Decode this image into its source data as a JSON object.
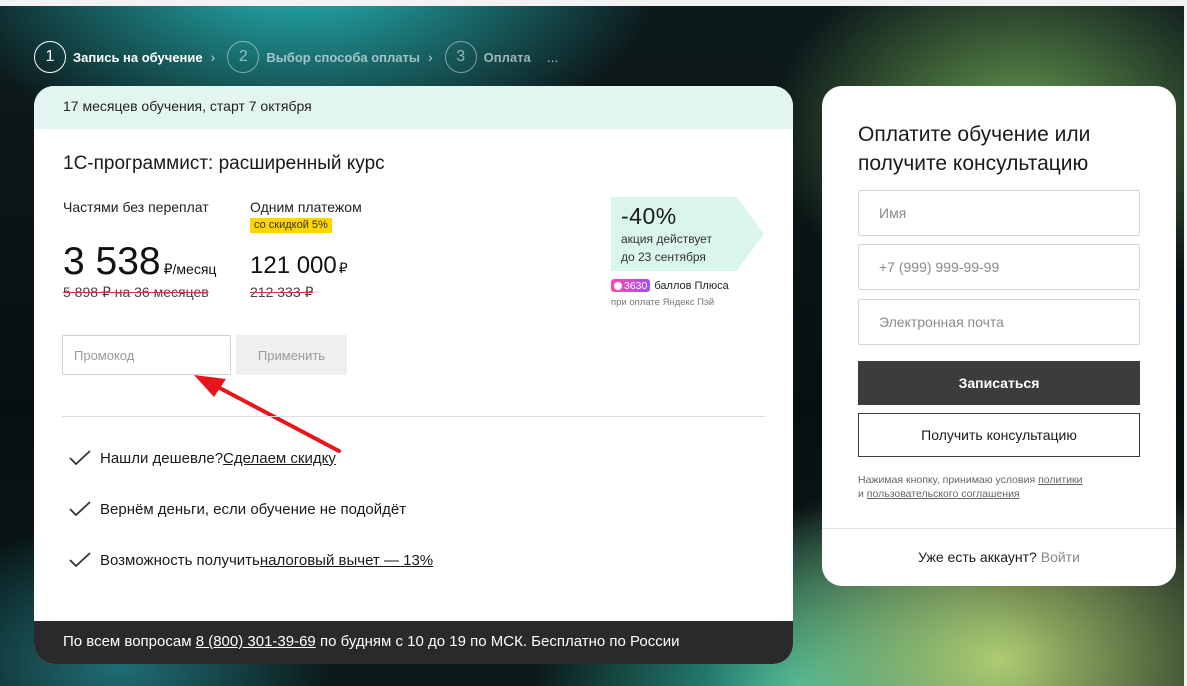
{
  "stepper": {
    "steps": [
      {
        "num": "1",
        "label": "Запись на обучение"
      },
      {
        "num": "2",
        "label": "Выбор способа оплаты"
      },
      {
        "num": "3",
        "label": "Оплата"
      }
    ],
    "more": "..."
  },
  "course": {
    "duration": "17 месяцев обучения, старт 7 октября",
    "title": "1С-программист: расширенный курс"
  },
  "pricing": {
    "installment": {
      "caption": "Частями без переплат",
      "amount": "3 538",
      "unit": "₽/месяц",
      "old": "5 898 ₽ на 36 месяцев"
    },
    "single": {
      "caption": "Одним платежом",
      "tag": "со скидкой 5%",
      "amount": "121 000",
      "unit": "₽",
      "old": "212 333 ₽"
    }
  },
  "promo": {
    "percent": "-40%",
    "line1": "акция действует",
    "line2": "до 23 сентября",
    "plus_points": "3630",
    "plus_label": "баллов Плюса",
    "plus_sub": "при оплате Яндекс Пэй"
  },
  "promocode": {
    "placeholder": "Промокод",
    "apply": "Применить"
  },
  "benefits": [
    {
      "text": "Нашли дешевле? ",
      "link": "Сделаем скидку"
    },
    {
      "text": "Вернём деньги, если обучение не подойдёт",
      "link": ""
    },
    {
      "text": "Возможность получить ",
      "link": "налоговый вычет — 13%"
    }
  ],
  "footer": {
    "prefix": "По всем вопросам ",
    "phone": "8 (800) 301-39-69",
    "suffix": " по будням с 10 до 19 по МСК. Бесплатно по России"
  },
  "form": {
    "title": "Оплатите обучение или получите консультацию",
    "name_placeholder": "Имя",
    "phone_placeholder": "+7 (999) 999-99-99",
    "email_placeholder": "Электронная почта",
    "submit": "Записаться",
    "consult": "Получить консультацию",
    "legal_prefix": "Нажимая кнопку, принимаю условия ",
    "legal_policy": "политики",
    "legal_and": "и ",
    "legal_agreement": "пользовательского соглашения",
    "account_text": "Уже есть аккаунт?",
    "login": "Войти"
  },
  "colors": {
    "promo_bg": "#d9f5ec",
    "header_bg": "#e3f5f1",
    "discount_tag": "#ffd500",
    "primary_btn": "#3c3c3e",
    "footer_bg": "#2a2a2c",
    "annotation_arrow": "#e8161c"
  }
}
